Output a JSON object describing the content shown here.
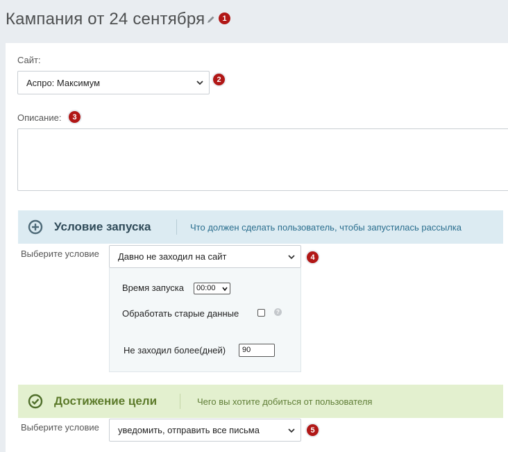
{
  "header": {
    "title": "Кампания от 24 сентября",
    "badge": "1"
  },
  "site": {
    "label": "Сайт:",
    "value": "Аспро: Максимум",
    "badge": "2"
  },
  "description": {
    "label": "Описание:",
    "badge": "3",
    "value": ""
  },
  "launch": {
    "title": "Условие запуска",
    "hint": "Что должен сделать пользователь, чтобы запустилась рассылка",
    "condition_label": "Выберите условие",
    "condition_value": "Давно не заходил на сайт",
    "badge": "4",
    "time_label": "Время запуска",
    "time_value": "00:00",
    "process_old_label": "Обработать старые данные",
    "process_old_checked": false,
    "help_glyph": "?",
    "days_label": "Не заходил более(дней)",
    "days_value": "90"
  },
  "goal": {
    "title": "Достижение цели",
    "hint": "Чего вы хотите добиться от пользователя",
    "condition_label": "Выберите условие",
    "condition_value": "уведомить, отправить все письма",
    "badge": "5"
  },
  "colors": {
    "badge": "#b11716",
    "launch_bar": "#dcebf2",
    "goal_bar": "#e3f0cf",
    "page_bg": "#e9edf1"
  },
  "icons": {
    "edit": "pencil-icon",
    "select": "chevron-down-icon",
    "launch": "plus-circle-icon",
    "goal": "check-circle-icon",
    "help": "question-circle-icon"
  }
}
